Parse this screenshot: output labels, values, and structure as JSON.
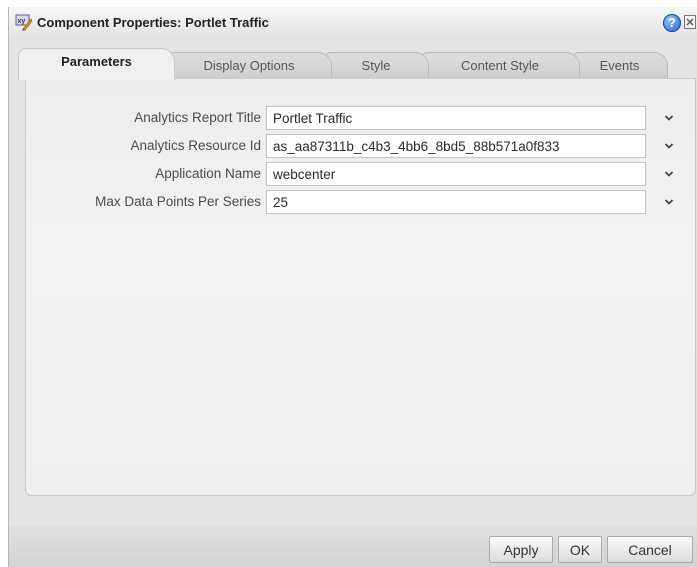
{
  "dialog": {
    "title": "Component Properties: Portlet Traffic",
    "title_icon": "chart-xy-icon",
    "help_icon": "help-icon",
    "help_glyph": "?",
    "close_icon": "close-icon"
  },
  "tabs": [
    {
      "label": "Parameters",
      "active": true
    },
    {
      "label": "Display Options",
      "active": false
    },
    {
      "label": "Style",
      "active": false
    },
    {
      "label": "Content Style",
      "active": false
    },
    {
      "label": "Events",
      "active": false
    }
  ],
  "parameters": [
    {
      "label": "Analytics Report Title",
      "value": "Portlet Traffic"
    },
    {
      "label": "Analytics Resource Id",
      "value": "as_aa87311b_c4b3_4bb6_8bd5_88b571a0f833"
    },
    {
      "label": "Application Name",
      "value": "webcenter"
    },
    {
      "label": "Max Data Points Per Series",
      "value": "25"
    }
  ],
  "buttons": {
    "apply": "Apply",
    "ok": "OK",
    "cancel": "Cancel"
  }
}
